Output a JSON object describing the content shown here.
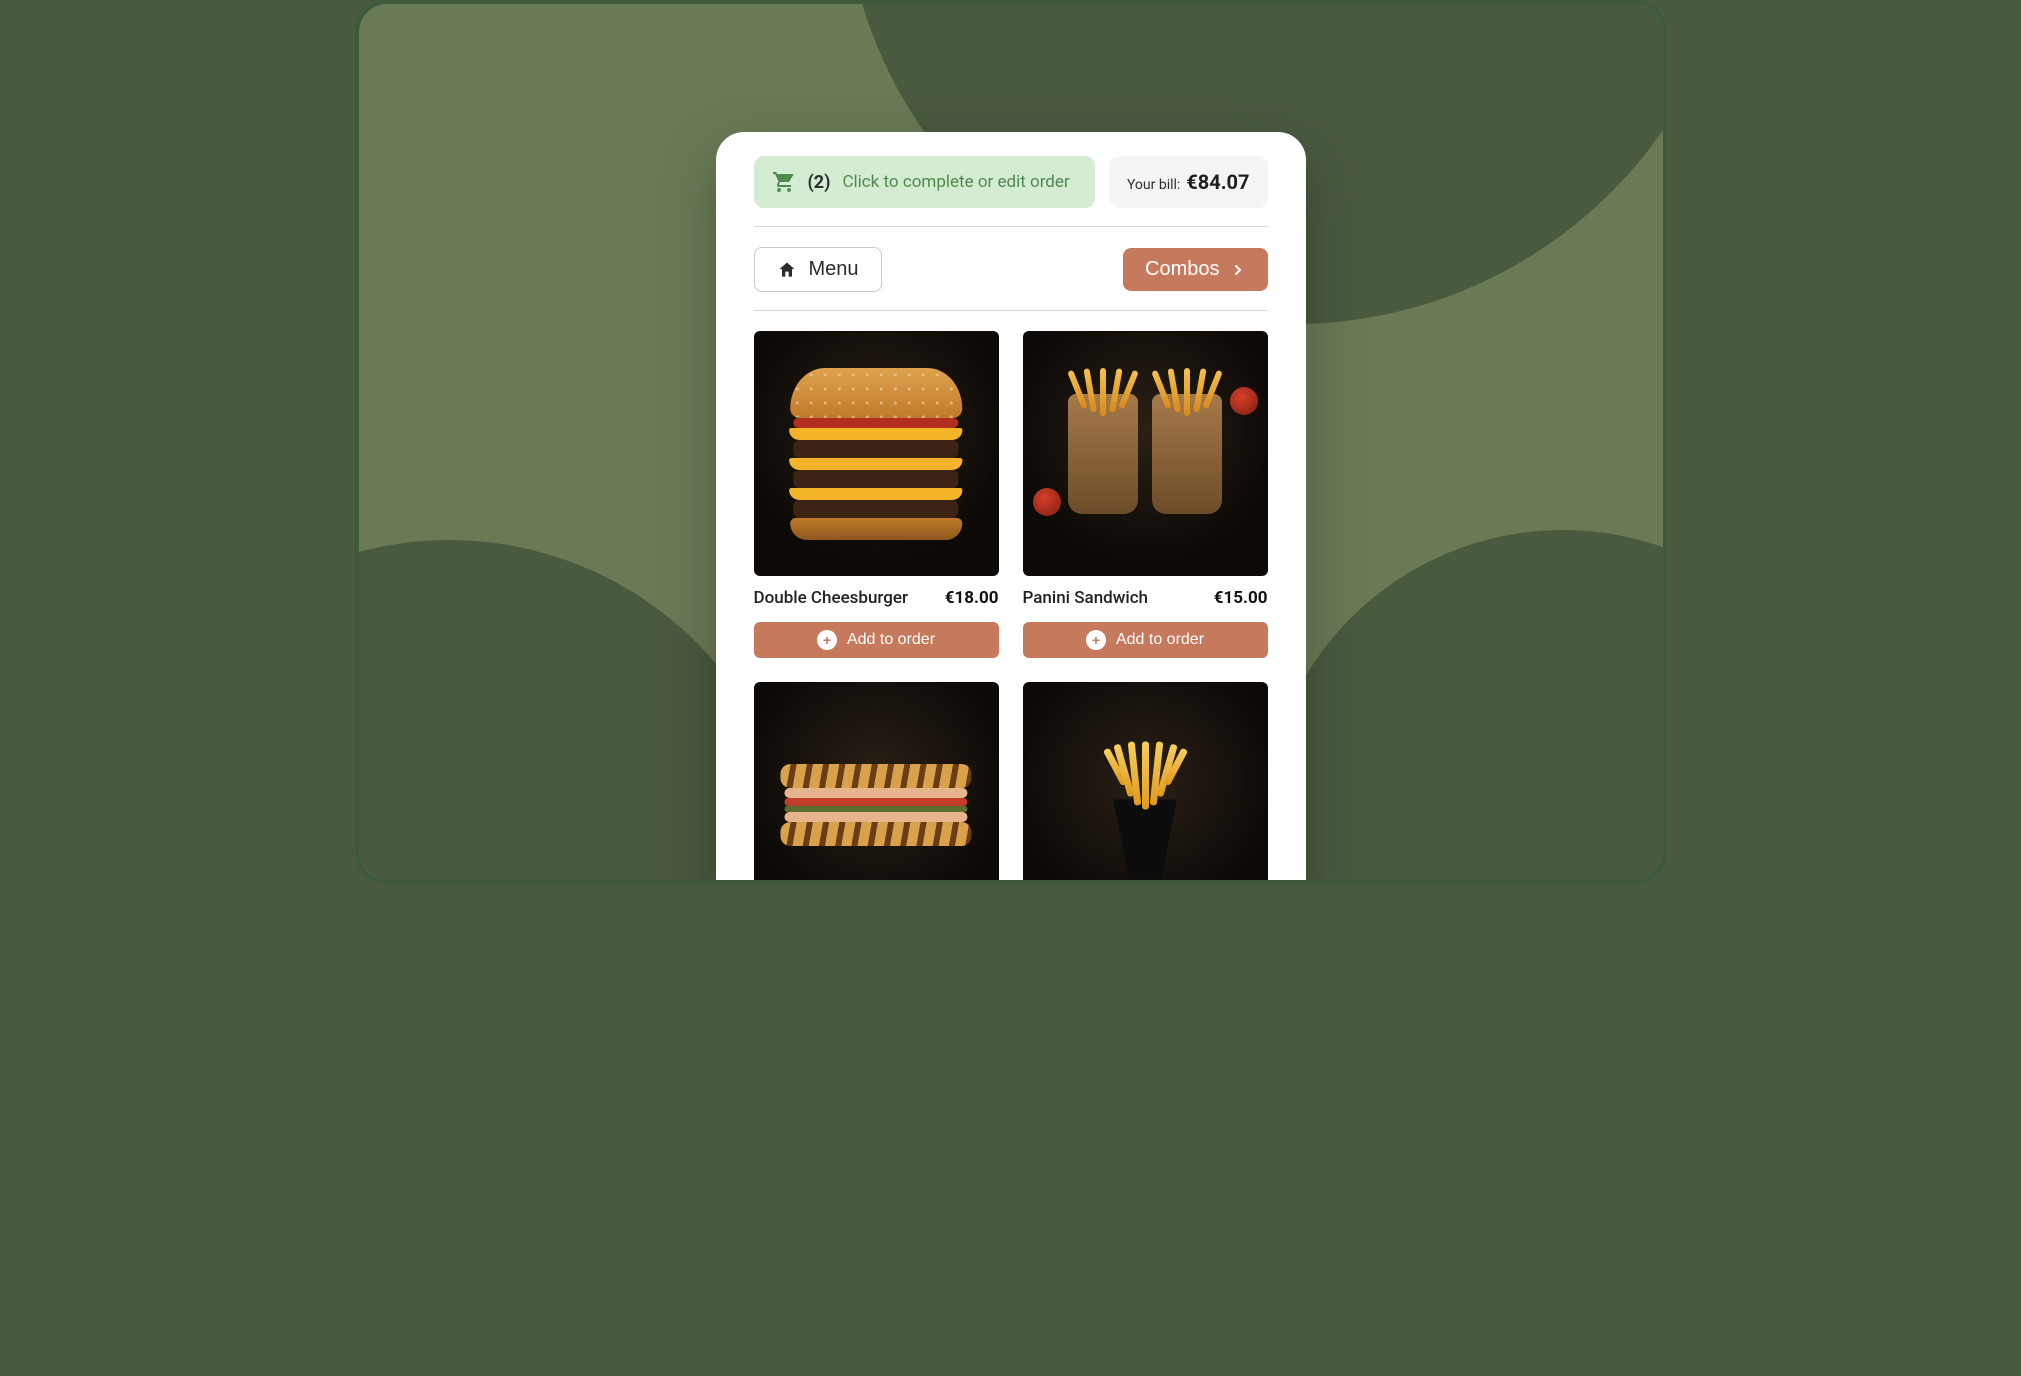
{
  "cart": {
    "count_display": "(2)",
    "label": "Click to complete or edit order"
  },
  "bill": {
    "label": "Your bill:",
    "amount": "€84.07"
  },
  "nav": {
    "menu_label": "Menu",
    "combos_label": "Combos"
  },
  "add_label": "Add to order",
  "items": [
    {
      "name": "Double Cheesburger",
      "price": "€18.00"
    },
    {
      "name": "Panini Sandwich",
      "price": "€15.00"
    }
  ]
}
